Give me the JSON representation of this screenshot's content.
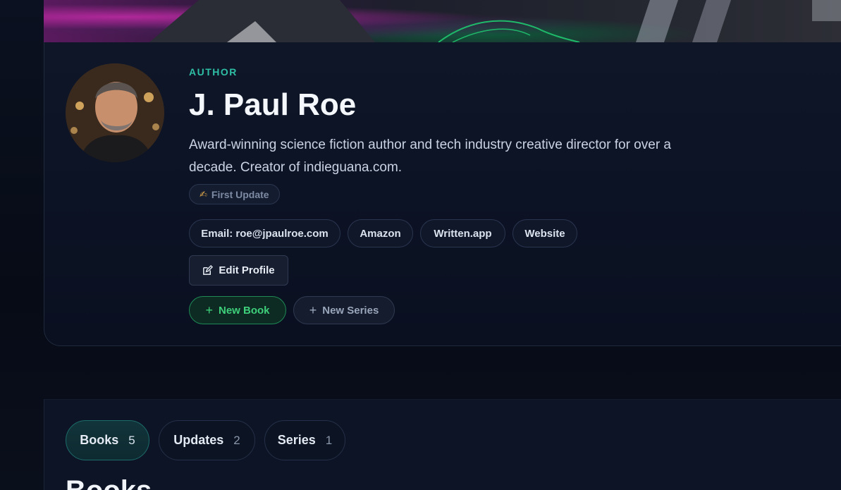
{
  "profile": {
    "role": "AUTHOR",
    "name": "J. Paul Roe",
    "bio": "Award-winning science fiction author and tech industry creative director for over a decade. Creator of indieguana.com.",
    "first_update_badge": {
      "icon": "writing-hand-icon",
      "glyph": "✍",
      "label": "First Update"
    }
  },
  "links": {
    "email": "Email: roe@jpaulroe.com",
    "amazon": "Amazon",
    "written": "Written.app",
    "website": "Website"
  },
  "actions": {
    "edit_profile": "Edit Profile",
    "new_book": "New Book",
    "new_series": "New Series"
  },
  "tabs": [
    {
      "label": "Books",
      "count": "5",
      "active": true
    },
    {
      "label": "Updates",
      "count": "2",
      "active": false
    },
    {
      "label": "Series",
      "count": "1",
      "active": false
    }
  ],
  "section": {
    "heading": "Books"
  },
  "colors": {
    "accent_teal": "#2fbfa6",
    "new_book_green": "#3ed07a",
    "background": "#0a0f1c"
  }
}
